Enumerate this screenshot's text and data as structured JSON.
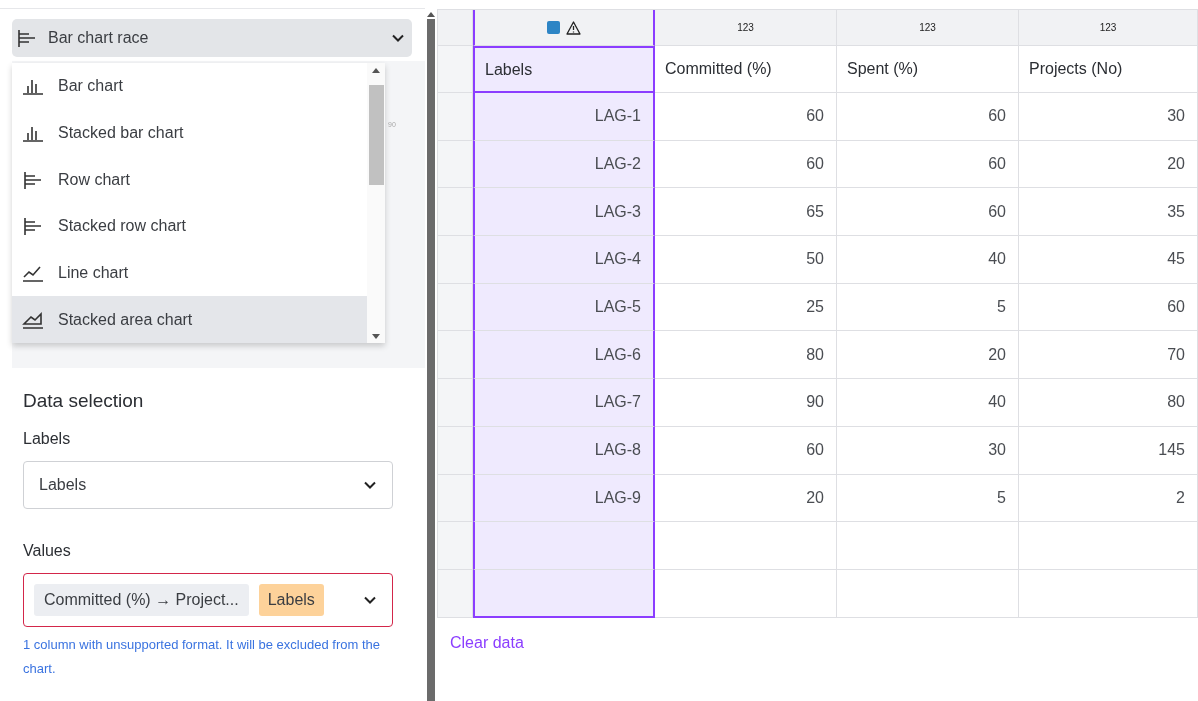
{
  "chart_type_select": {
    "value": "Bar chart race",
    "kind": "row"
  },
  "chart_type_menu": [
    {
      "label": "Bar chart",
      "kind": "bar",
      "selected": false
    },
    {
      "label": "Stacked bar chart",
      "kind": "bar",
      "selected": false
    },
    {
      "label": "Row chart",
      "kind": "row",
      "selected": false
    },
    {
      "label": "Stacked row chart",
      "kind": "row",
      "selected": false
    },
    {
      "label": "Line chart",
      "kind": "line",
      "selected": false
    },
    {
      "label": "Stacked area chart",
      "kind": "area",
      "selected": true
    }
  ],
  "preview_tick": "90",
  "data_selection": {
    "title": "Data selection",
    "labels_field": {
      "label": "Labels",
      "value": "Labels"
    },
    "values_field": {
      "label": "Values",
      "chip": "Committed (%) → Project...",
      "tag": "Labels",
      "invalid": true
    },
    "help_text": "1 column with unsupported format. It will be excluded from the chart."
  },
  "table": {
    "column_types": [
      {
        "kind": "warning"
      },
      {
        "kind": "number",
        "text": "123"
      },
      {
        "kind": "number",
        "text": "123"
      },
      {
        "kind": "number",
        "text": "123"
      }
    ],
    "columns": [
      {
        "name": "Labels",
        "selected": true
      },
      {
        "name": "Committed (%)",
        "selected": false
      },
      {
        "name": "Spent (%)",
        "selected": false
      },
      {
        "name": "Projects (No)",
        "selected": false
      }
    ],
    "rows": [
      [
        "LAG-1",
        "60",
        "60",
        "30"
      ],
      [
        "LAG-2",
        "60",
        "60",
        "20"
      ],
      [
        "LAG-3",
        "65",
        "60",
        "35"
      ],
      [
        "LAG-4",
        "50",
        "40",
        "45"
      ],
      [
        "LAG-5",
        "25",
        "5",
        "60"
      ],
      [
        "LAG-6",
        "80",
        "20",
        "70"
      ],
      [
        "LAG-7",
        "90",
        "40",
        "80"
      ],
      [
        "LAG-8",
        "60",
        "30",
        "145"
      ],
      [
        "LAG-9",
        "20",
        "5",
        "2"
      ]
    ]
  },
  "clear_button": "Clear data"
}
